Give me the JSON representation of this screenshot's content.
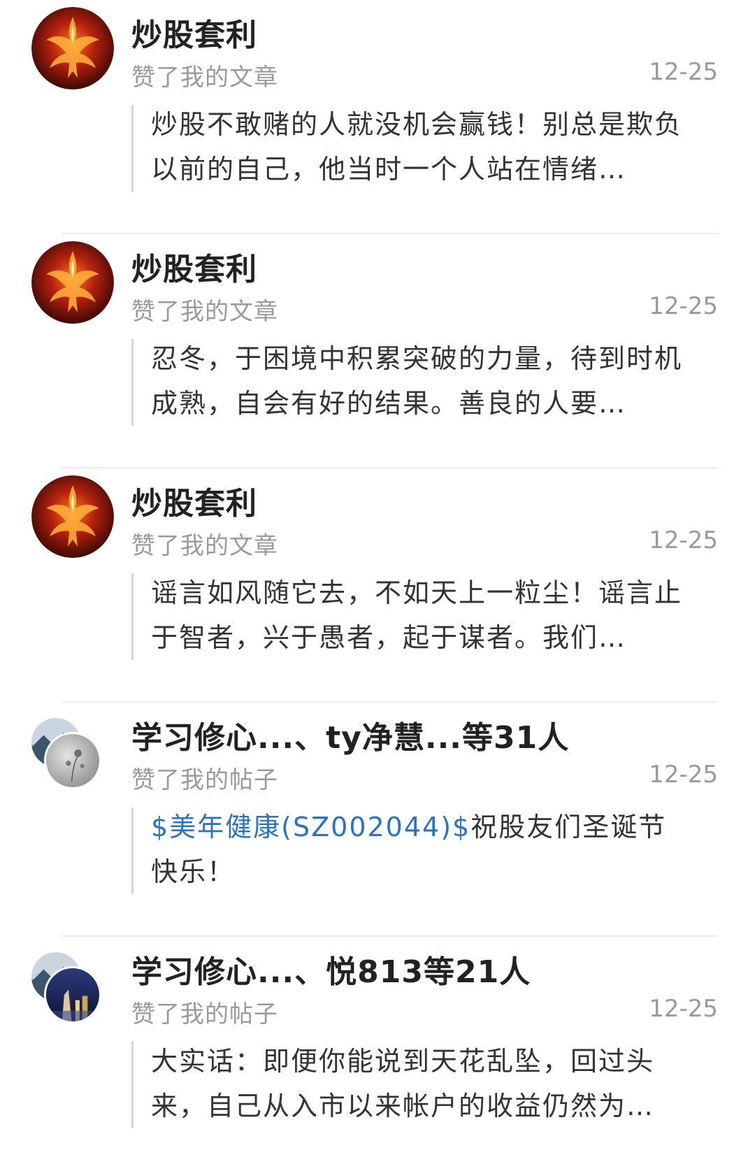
{
  "notifications": [
    {
      "avatar": "phoenix-avatar",
      "name": "炒股套利",
      "action": "赞了我的文章",
      "time": "12-25",
      "quote": "炒股不敢赌的人就没机会赢钱！别总是欺负以前的自己，他当时一个人站在情绪…"
    },
    {
      "avatar": "phoenix-avatar",
      "name": "炒股套利",
      "action": "赞了我的文章",
      "time": "12-25",
      "quote": "忍冬，于困境中积累突破的力量，待到时机成熟，自会有好的结果。善良的人要…"
    },
    {
      "avatar": "phoenix-avatar",
      "name": "炒股套利",
      "action": "赞了我的文章",
      "time": "12-25",
      "quote": "谣言如风随它去，不如天上一粒尘！谣言止于智者，兴于愚者，起于谋者。我们…"
    },
    {
      "avatar": "stacked-avatar",
      "name": "学习修心...、ty净慧...等31人",
      "action": "赞了我的帖子",
      "time": "12-25",
      "quote_link": "$美年健康(SZ002044)$",
      "quote": "祝股友们圣诞节快乐！"
    },
    {
      "avatar": "stacked-avatar",
      "name": "学习修心...、悦813等21人",
      "action": "赞了我的帖子",
      "time": "12-25",
      "quote": "大实话：即便你能说到天花乱坠，回过头来，自己从入市以来帐户的收益仍然为…"
    }
  ],
  "colors": {
    "link": "#2a72c8",
    "secondary_text": "#9a9a9a",
    "divider": "#ececec"
  }
}
